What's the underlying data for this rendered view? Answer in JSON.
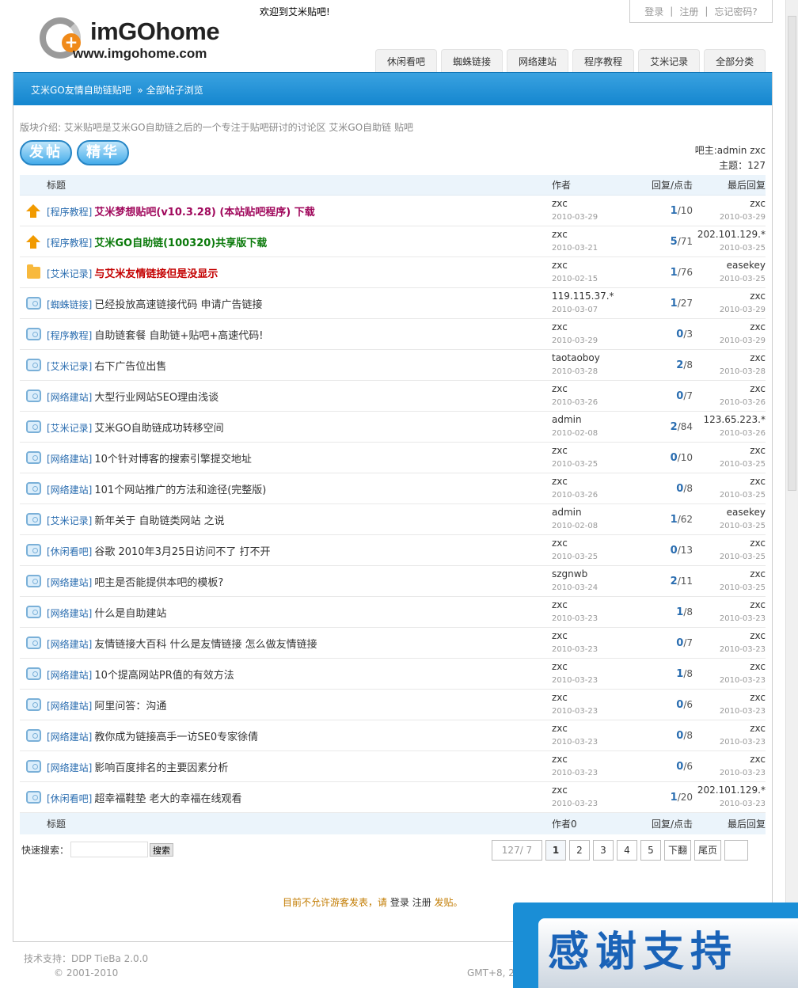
{
  "header": {
    "logo_name": "imGOhome",
    "logo_url": "www.imgohome.com",
    "welcome": "欢迎到艾米贴吧!",
    "user_links": [
      "登录",
      "注册",
      "忘记密码?"
    ],
    "user_sep": "|",
    "nav_tabs": [
      "休闲看吧",
      "蜘蛛链接",
      "网络建站",
      "程序教程",
      "艾米记录",
      "全部分类"
    ]
  },
  "breadcrumb": {
    "home": "艾米GO友情自助链贴吧",
    "sep": "»",
    "current": "全部帖子浏览"
  },
  "forum": {
    "intro": "版块介绍: 艾米贴吧是艾米GO自助链之后的一个专注于贴吧研讨的讨论区 艾米GO自助链 贴吧",
    "post_button": "发帖",
    "digest_button": "精华",
    "moderators": "吧主:admin zxc",
    "topic_count": "主题：127"
  },
  "table": {
    "headers": {
      "title": "标题",
      "author": "作者",
      "replies": "回复/点击",
      "last": "最后回复"
    },
    "footer": {
      "title": "标题",
      "author": "作者0",
      "replies": "回复/点击",
      "last": "最后回复"
    },
    "rows": [
      {
        "icon": "up",
        "tag": "[程序教程]",
        "title": "艾米梦想贴吧(v10.3.28) (本站贴吧程序) 下载",
        "style": "purple",
        "author": "zxc",
        "date": "2010-03-29",
        "replies": "1",
        "clicks": "/10",
        "last_user": "zxc",
        "last_date": "2010-03-29"
      },
      {
        "icon": "up",
        "tag": "[程序教程]",
        "title": "艾米GO自助链(100320)共享版下载",
        "style": "green",
        "author": "zxc",
        "date": "2010-03-21",
        "replies": "5",
        "clicks": "/71",
        "last_user": "202.101.129.*",
        "last_date": "2010-03-25"
      },
      {
        "icon": "folder",
        "tag": "[艾米记录]",
        "title": "与艾米友情链接但是没显示",
        "style": "red",
        "author": "zxc",
        "date": "2010-02-15",
        "replies": "1",
        "clicks": "/76",
        "last_user": "easekey",
        "last_date": "2010-03-25"
      },
      {
        "icon": "bubble",
        "tag": "[蜘蛛链接]",
        "title": "已经投放高速链接代码 申请广告链接",
        "style": "normal",
        "author": "119.115.37.*",
        "date": "2010-03-07",
        "replies": "1",
        "clicks": "/27",
        "last_user": "zxc",
        "last_date": "2010-03-29"
      },
      {
        "icon": "bubble",
        "tag": "[程序教程]",
        "title": "自助链套餐 自助链+贴吧+高速代码!",
        "style": "normal",
        "author": "zxc",
        "date": "2010-03-29",
        "replies": "0",
        "clicks": "/3",
        "last_user": "zxc",
        "last_date": "2010-03-29"
      },
      {
        "icon": "bubble",
        "tag": "[艾米记录]",
        "title": "右下广告位出售",
        "style": "normal",
        "author": "taotaoboy",
        "date": "2010-03-28",
        "replies": "2",
        "clicks": "/8",
        "last_user": "zxc",
        "last_date": "2010-03-28"
      },
      {
        "icon": "bubble",
        "tag": "[网络建站]",
        "title": "大型行业网站SEO理由浅谈",
        "style": "normal",
        "author": "zxc",
        "date": "2010-03-26",
        "replies": "0",
        "clicks": "/7",
        "last_user": "zxc",
        "last_date": "2010-03-26"
      },
      {
        "icon": "bubble",
        "tag": "[艾米记录]",
        "title": "艾米GO自助链成功转移空间",
        "style": "normal",
        "author": "admin",
        "date": "2010-02-08",
        "replies": "2",
        "clicks": "/84",
        "last_user": "123.65.223.*",
        "last_date": "2010-03-26"
      },
      {
        "icon": "bubble",
        "tag": "[网络建站]",
        "title": "10个针对博客的搜索引擎提交地址",
        "style": "normal",
        "author": "zxc",
        "date": "2010-03-25",
        "replies": "0",
        "clicks": "/10",
        "last_user": "zxc",
        "last_date": "2010-03-25"
      },
      {
        "icon": "bubble",
        "tag": "[网络建站]",
        "title": "101个网站推广的方法和途径(完整版)",
        "style": "normal",
        "author": "zxc",
        "date": "2010-03-26",
        "replies": "0",
        "clicks": "/8",
        "last_user": "zxc",
        "last_date": "2010-03-25"
      },
      {
        "icon": "bubble",
        "tag": "[艾米记录]",
        "title": "新年关于 自助链类网站 之说",
        "style": "normal",
        "author": "admin",
        "date": "2010-02-08",
        "replies": "1",
        "clicks": "/62",
        "last_user": "easekey",
        "last_date": "2010-03-25"
      },
      {
        "icon": "bubble",
        "tag": "[休闲看吧]",
        "title": "谷歌 2010年3月25日访问不了 打不开",
        "style": "normal",
        "author": "zxc",
        "date": "2010-03-25",
        "replies": "0",
        "clicks": "/13",
        "last_user": "zxc",
        "last_date": "2010-03-25"
      },
      {
        "icon": "bubble",
        "tag": "[网络建站]",
        "title": "吧主是否能提供本吧的模板?",
        "style": "normal",
        "author": "szgnwb",
        "date": "2010-03-24",
        "replies": "2",
        "clicks": "/11",
        "last_user": "zxc",
        "last_date": "2010-03-25"
      },
      {
        "icon": "bubble",
        "tag": "[网络建站]",
        "title": "什么是自助建站",
        "style": "normal",
        "author": "zxc",
        "date": "2010-03-23",
        "replies": "1",
        "clicks": "/8",
        "last_user": "zxc",
        "last_date": "2010-03-23"
      },
      {
        "icon": "bubble",
        "tag": "[网络建站]",
        "title": "友情链接大百科 什么是友情链接 怎么做友情链接",
        "style": "normal",
        "author": "zxc",
        "date": "2010-03-23",
        "replies": "0",
        "clicks": "/7",
        "last_user": "zxc",
        "last_date": "2010-03-23"
      },
      {
        "icon": "bubble",
        "tag": "[网络建站]",
        "title": "10个提高网站PR值的有效方法",
        "style": "normal",
        "author": "zxc",
        "date": "2010-03-23",
        "replies": "1",
        "clicks": "/8",
        "last_user": "zxc",
        "last_date": "2010-03-23"
      },
      {
        "icon": "bubble",
        "tag": "[网络建站]",
        "title": "阿里问答：沟通",
        "style": "normal",
        "author": "zxc",
        "date": "2010-03-23",
        "replies": "0",
        "clicks": "/6",
        "last_user": "zxc",
        "last_date": "2010-03-23"
      },
      {
        "icon": "bubble",
        "tag": "[网络建站]",
        "title": "教你成为链接高手一访SE0专家徐倩",
        "style": "normal",
        "author": "zxc",
        "date": "2010-03-23",
        "replies": "0",
        "clicks": "/8",
        "last_user": "zxc",
        "last_date": "2010-03-23"
      },
      {
        "icon": "bubble",
        "tag": "[网络建站]",
        "title": "影响百度排名的主要因素分析",
        "style": "normal",
        "author": "zxc",
        "date": "2010-03-23",
        "replies": "0",
        "clicks": "/6",
        "last_user": "zxc",
        "last_date": "2010-03-23"
      },
      {
        "icon": "bubble",
        "tag": "[休闲看吧]",
        "title": "超幸福鞋垫 老大的幸福在线观看",
        "style": "normal",
        "author": "zxc",
        "date": "2010-03-23",
        "replies": "1",
        "clicks": "/20",
        "last_user": "202.101.129.*",
        "last_date": "2010-03-23"
      }
    ]
  },
  "search": {
    "label": "快速搜索：",
    "button": "搜索",
    "value": ""
  },
  "pager": {
    "count": "127/ 7",
    "pages": [
      "1",
      "2",
      "3",
      "4",
      "5"
    ],
    "next": "下翻",
    "last": "尾页"
  },
  "notice": {
    "prefix": "目前不允许游客发表，请",
    "login": "登录",
    "register": "注册",
    "post": "发贴。"
  },
  "footer": {
    "tech": "技术支持：DDP TieBa 2.0.0",
    "copyright": "© 2001-2010",
    "gmt": "GMT+8, 2"
  },
  "promo": {
    "text": "感谢支持"
  },
  "colors": {
    "accent": "#1486cf",
    "hot_purple": "#a0085c",
    "hot_green": "#0b7a0b",
    "hot_red": "#c40000",
    "tag": "#2a6db0"
  }
}
